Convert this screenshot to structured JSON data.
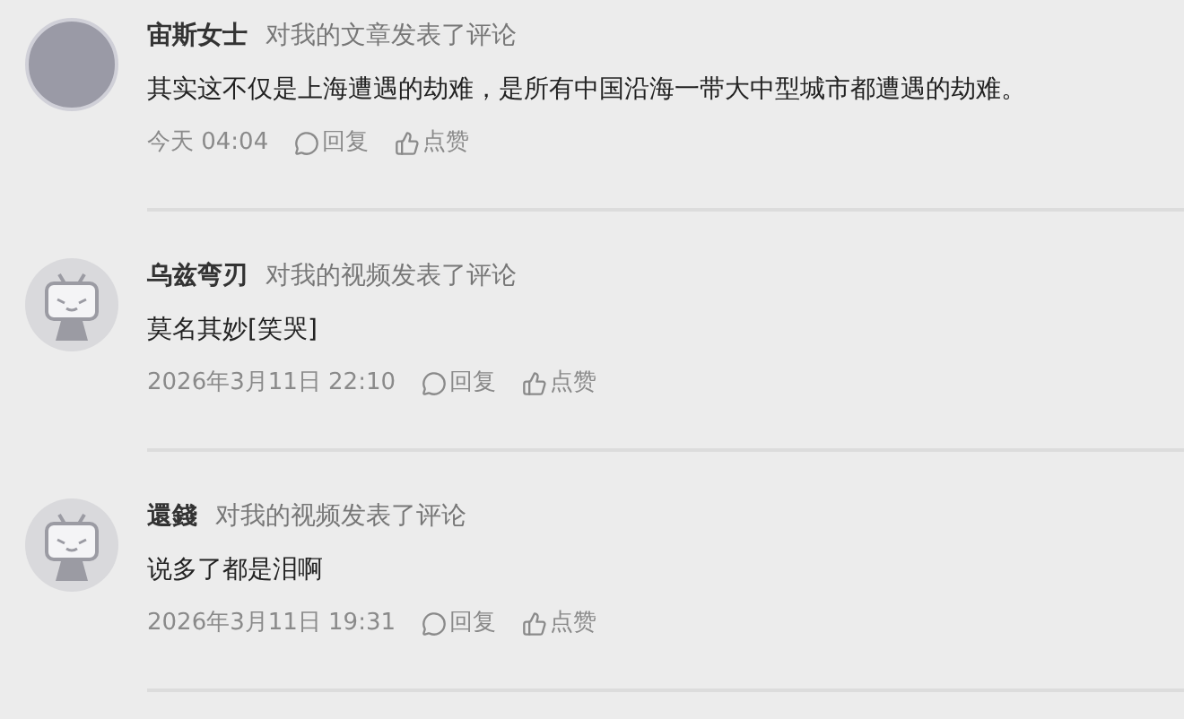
{
  "notifications": [
    {
      "avatar": {
        "kind": "photo"
      },
      "name": "宙斯女士",
      "action": "对我的文章发表了评论",
      "content": "其实这不仅是上海遭遇的劫难，是所有中国沿海一带大中型城市都遭遇的劫难。",
      "time": "今天 04:04",
      "reply": "回复",
      "like": "点赞"
    },
    {
      "avatar": {
        "kind": "default"
      },
      "name": "乌兹弯刃",
      "action": "对我的视频发表了评论",
      "content": "莫名其妙[笑哭]",
      "time": "2026年3月11日 22:10",
      "reply": "回复",
      "like": "点赞"
    },
    {
      "avatar": {
        "kind": "default"
      },
      "name": "還錢",
      "action": "对我的视频发表了评论",
      "content": "说多了都是泪啊",
      "time": "2026年3月11日 19:31",
      "reply": "回复",
      "like": "点赞"
    }
  ]
}
